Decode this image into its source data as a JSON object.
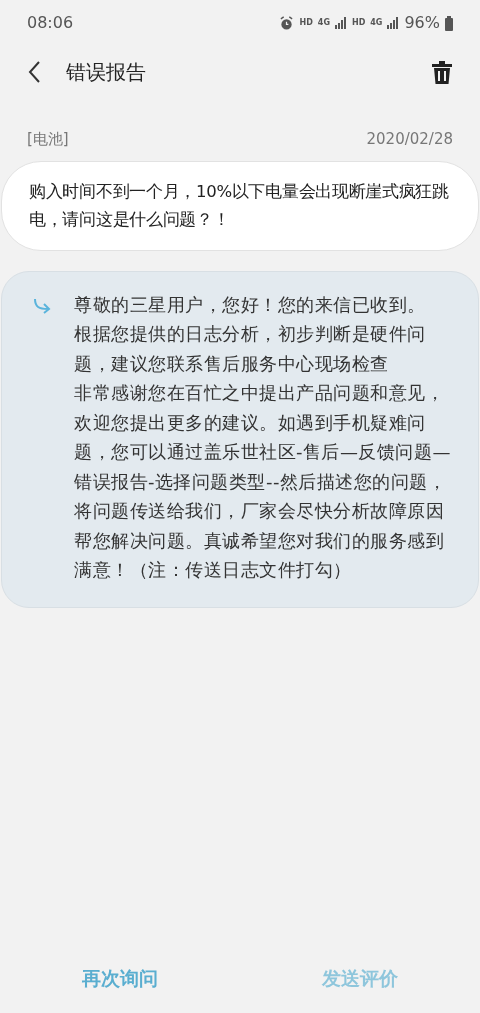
{
  "status_bar": {
    "time": "08:06",
    "indicators": [
      "HD",
      "4G",
      "HD",
      "4G"
    ],
    "battery": "96%"
  },
  "header": {
    "title": "错误报告"
  },
  "report": {
    "category": "[电池]",
    "date": "2020/02/28",
    "question": "购入时间不到一个月，10%以下电量会出现断崖式疯狂跳电，请问这是什么问题？！"
  },
  "reply": {
    "paragraphs": [
      "尊敬的三星用户，您好！您的来信已收到。",
      "根据您提供的日志分析，初步判断是硬件问题，建议您联系售后服务中心现场检查",
      "非常感谢您在百忙之中提出产品问题和意见，欢迎您提出更多的建议。如遇到手机疑难问题，您可以通过盖乐世社区-售后—反馈问题—错误报告-选择问题类型--然后描述您的问题，将问题传送给我们，厂家会尽快分析故障原因帮您解决问题。真诚希望您对我们的服务感到满意！（注：传送日志文件打勾）"
    ]
  },
  "buttons": [
    {
      "label": "再次询问",
      "disabled": false
    },
    {
      "label": "发送评价",
      "disabled": true
    }
  ]
}
